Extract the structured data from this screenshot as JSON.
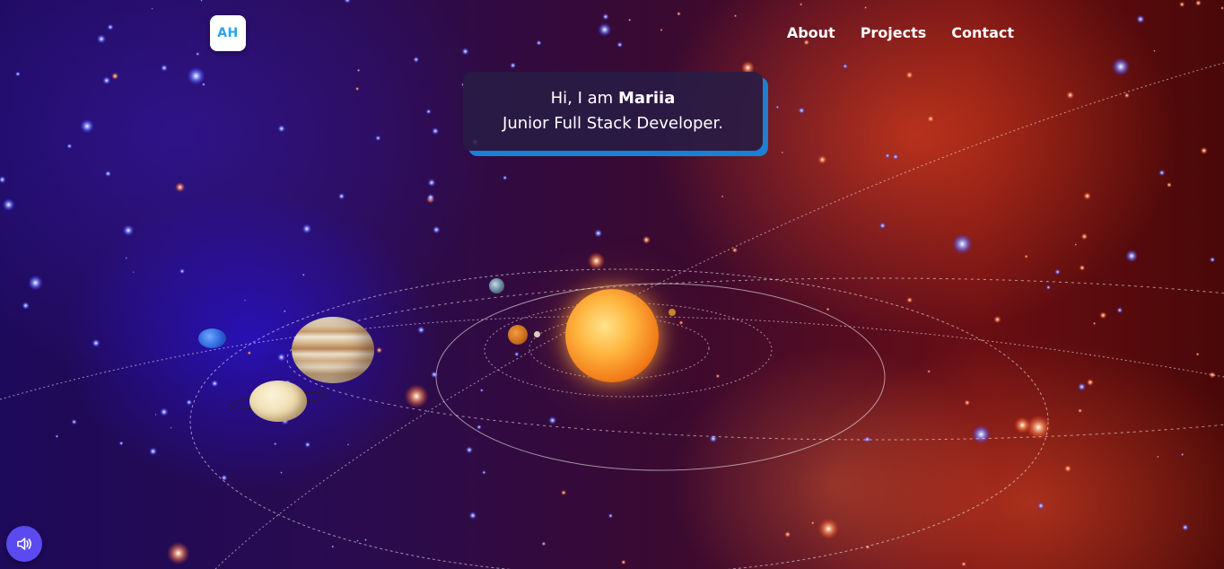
{
  "header": {
    "logo_text": "AH",
    "nav": [
      {
        "label": "About"
      },
      {
        "label": "Projects"
      },
      {
        "label": "Contact"
      }
    ]
  },
  "intro": {
    "greeting": "Hi, I am ",
    "name": "Mariia",
    "role": "Junior Full Stack Developer."
  },
  "controls": {
    "sound_icon": "speaker-icon"
  },
  "colors": {
    "logo_text": "#2aa3f0",
    "intro_accent": "#1b7fd6",
    "sound_button": "#5b4af0"
  }
}
